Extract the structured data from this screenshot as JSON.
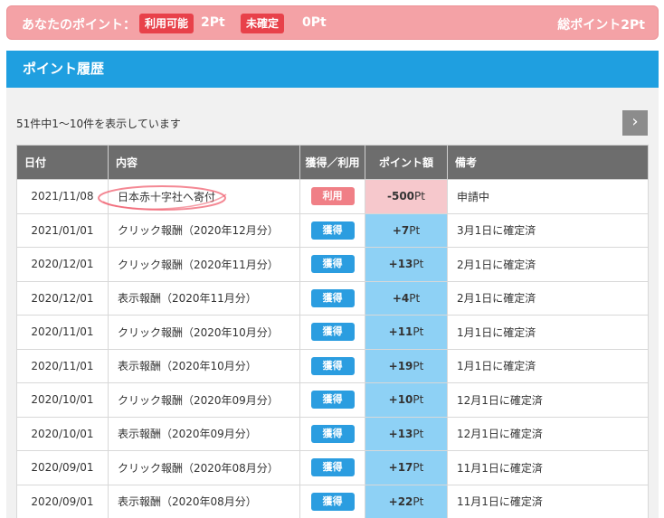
{
  "topbar": {
    "label": "あなたのポイント：",
    "available_badge": "利用可能",
    "available_value": "2Pt",
    "pending_badge": "未確定",
    "pending_value": "0Pt",
    "total": "総ポイント2Pt"
  },
  "panel": {
    "title": "ポイント履歴",
    "summary": "51件中1～10件を表示しています",
    "next_icon": "chevron-right-icon"
  },
  "table": {
    "headers": [
      "日付",
      "内容",
      "獲得／利用",
      "ポイント額",
      "備考"
    ],
    "rows": [
      {
        "date": "2021/11/08",
        "content": "日本赤十字社へ寄付",
        "type": "利用",
        "kind": "use",
        "amount": "-500",
        "unit": "Pt",
        "note": "申請中"
      },
      {
        "date": "2021/01/01",
        "content": "クリック報酬（2020年12月分）",
        "type": "獲得",
        "kind": "earn",
        "amount": "+7",
        "unit": "Pt",
        "note": "3月1日に確定済"
      },
      {
        "date": "2020/12/01",
        "content": "クリック報酬（2020年11月分）",
        "type": "獲得",
        "kind": "earn",
        "amount": "+13",
        "unit": "Pt",
        "note": "2月1日に確定済"
      },
      {
        "date": "2020/12/01",
        "content": "表示報酬（2020年11月分）",
        "type": "獲得",
        "kind": "earn",
        "amount": "+4",
        "unit": "Pt",
        "note": "2月1日に確定済"
      },
      {
        "date": "2020/11/01",
        "content": "クリック報酬（2020年10月分）",
        "type": "獲得",
        "kind": "earn",
        "amount": "+11",
        "unit": "Pt",
        "note": "1月1日に確定済"
      },
      {
        "date": "2020/11/01",
        "content": "表示報酬（2020年10月分）",
        "type": "獲得",
        "kind": "earn",
        "amount": "+19",
        "unit": "Pt",
        "note": "1月1日に確定済"
      },
      {
        "date": "2020/10/01",
        "content": "クリック報酬（2020年09月分）",
        "type": "獲得",
        "kind": "earn",
        "amount": "+10",
        "unit": "Pt",
        "note": "12月1日に確定済"
      },
      {
        "date": "2020/10/01",
        "content": "表示報酬（2020年09月分）",
        "type": "獲得",
        "kind": "earn",
        "amount": "+13",
        "unit": "Pt",
        "note": "12月1日に確定済"
      },
      {
        "date": "2020/09/01",
        "content": "クリック報酬（2020年08月分）",
        "type": "獲得",
        "kind": "earn",
        "amount": "+17",
        "unit": "Pt",
        "note": "11月1日に確定済"
      },
      {
        "date": "2020/09/01",
        "content": "表示報酬（2020年08月分）",
        "type": "獲得",
        "kind": "earn",
        "amount": "+22",
        "unit": "Pt",
        "note": "11月1日に確定済"
      }
    ]
  },
  "colors": {
    "topbar_bg": "#f4a2a6",
    "badge_red": "#e8414a",
    "header_blue": "#1f9fe0",
    "earn_blue": "#2b9de0",
    "use_pink": "#f07f86",
    "amount_blue": "#8ed1f5",
    "amount_pink": "#f6c8cc",
    "annotation_circle": "#f06070"
  }
}
